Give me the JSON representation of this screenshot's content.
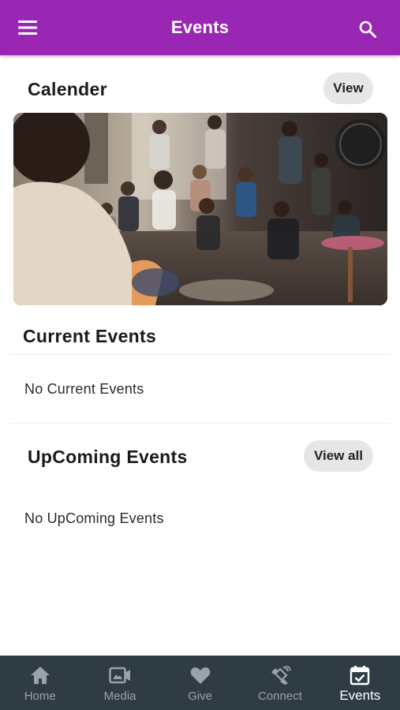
{
  "header": {
    "title": "Events",
    "menu_icon": "menu-icon",
    "search_icon": "search-icon",
    "background": "#9a26b4"
  },
  "calendar": {
    "title": "Calender",
    "view_label": "View",
    "image": "group-of-people-sitting-photo"
  },
  "current_events": {
    "title": "Current Events",
    "empty_text": "No Current Events"
  },
  "upcoming_events": {
    "title": "UpComing Events",
    "view_all_label": "View all",
    "empty_text": "No UpComing Events"
  },
  "bottom_nav": {
    "background": "#2f3c44",
    "items": [
      {
        "label": "Home",
        "icon": "home-icon",
        "active": false
      },
      {
        "label": "Media",
        "icon": "video-camera-icon",
        "active": false
      },
      {
        "label": "Give",
        "icon": "heart-icon",
        "active": false
      },
      {
        "label": "Connect",
        "icon": "connect-icon",
        "active": false
      },
      {
        "label": "Events",
        "icon": "calendar-check-icon",
        "active": true
      }
    ]
  }
}
